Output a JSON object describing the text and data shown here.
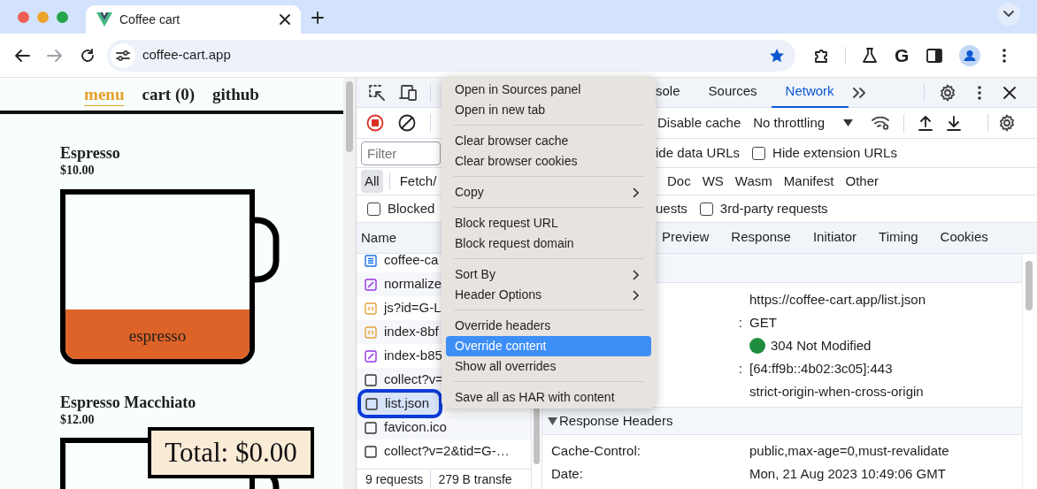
{
  "browser": {
    "tab_title": "Coffee cart",
    "url": "coffee-cart.app",
    "bookmarked": true,
    "extension_letter": "G"
  },
  "page": {
    "nav": [
      {
        "label": "menu",
        "selected": true
      },
      {
        "label": "cart (0)",
        "selected": false
      },
      {
        "label": "github",
        "selected": false
      }
    ],
    "products": [
      {
        "name": "Espresso",
        "price": "$10.00",
        "ingredient": "espresso"
      },
      {
        "name": "Espresso Macchiato",
        "price": "$12.00"
      }
    ],
    "total_button": "Total: $0.00"
  },
  "devtools": {
    "tabs": [
      {
        "label": "sole",
        "selected": false
      },
      {
        "label": "Sources",
        "selected": false
      },
      {
        "label": "Network",
        "selected": true
      }
    ],
    "recording": true,
    "disable_cache_label": "Disable cache",
    "throttling": "No throttling",
    "filter": {
      "placeholder": "Filter"
    },
    "hide_data_urls_label": "ide data URLs",
    "hide_extension_urls": {
      "label": "Hide extension URLs",
      "checked": false
    },
    "type_filters": [
      {
        "label": "All",
        "selected": true
      },
      {
        "label": "Fetch/",
        "selected": false
      },
      {
        "label": "Doc",
        "selected": false
      },
      {
        "label": "WS",
        "selected": false
      },
      {
        "label": "Wasm",
        "selected": false
      },
      {
        "label": "Manifest",
        "selected": false
      },
      {
        "label": "Other",
        "selected": false
      }
    ],
    "blocked": {
      "label": "Blocked",
      "checked": false
    },
    "requests_label": "uests",
    "third_party": {
      "label": "3rd-party requests",
      "checked": false
    },
    "name_column": "Name",
    "detail_tabs": [
      {
        "label": "Preview",
        "selected": false
      },
      {
        "label": "Response",
        "selected": false
      },
      {
        "label": "Initiator",
        "selected": false
      },
      {
        "label": "Timing",
        "selected": false
      },
      {
        "label": "Cookies",
        "selected": false
      }
    ],
    "requests": [
      {
        "name": "coffee-ca",
        "kind": "document",
        "selected": false
      },
      {
        "name": "normalize",
        "kind": "stylesheet",
        "selected": false
      },
      {
        "name": "js?id=G-L",
        "kind": "script",
        "selected": false
      },
      {
        "name": "index-8bf",
        "kind": "script",
        "selected": false
      },
      {
        "name": "index-b85",
        "kind": "stylesheet",
        "selected": false
      },
      {
        "name": "collect?v=",
        "kind": "other",
        "selected": false
      },
      {
        "name": "list.json",
        "kind": "other",
        "selected": true
      },
      {
        "name": "favicon.ico",
        "kind": "other",
        "selected": false
      },
      {
        "name": "collect?v=2&tid=G-…",
        "kind": "other",
        "selected": false
      }
    ],
    "footer": [
      "9 requests",
      "279 B transfe"
    ],
    "general": [
      {
        "value": "https://coffee-cart.app/list.json"
      },
      {
        "label": ":",
        "value": "GET"
      },
      {
        "value": "304 Not Modified",
        "color": "#1e8e3e"
      },
      {
        "label": ":",
        "value": "[64:ff9b::4b02:3c05]:443"
      },
      {
        "value": "strict-origin-when-cross-origin"
      }
    ],
    "response_headers": {
      "title": "Response Headers",
      "expanded": true,
      "rows": [
        {
          "name": "Cache-Control:",
          "value": "public,max-age=0,must-revalidate"
        },
        {
          "name": "Date:",
          "value": "Mon, 21 Aug 2023 10:49:06 GMT"
        }
      ]
    }
  },
  "context_menu": {
    "groups": [
      [
        {
          "label": "Open in Sources panel",
          "submenu": false,
          "selected": false
        },
        {
          "label": "Open in new tab",
          "submenu": false,
          "selected": false
        }
      ],
      [
        {
          "label": "Clear browser cache",
          "submenu": false,
          "selected": false
        },
        {
          "label": "Clear browser cookies",
          "submenu": false,
          "selected": false
        }
      ],
      [
        {
          "label": "Copy",
          "submenu": true,
          "selected": false
        }
      ],
      [
        {
          "label": "Block request URL",
          "submenu": false,
          "selected": false
        },
        {
          "label": "Block request domain",
          "submenu": false,
          "selected": false
        }
      ],
      [
        {
          "label": "Sort By",
          "submenu": true,
          "selected": false
        },
        {
          "label": "Header Options",
          "submenu": true,
          "selected": false
        }
      ],
      [
        {
          "label": "Override headers",
          "submenu": false,
          "selected": false
        },
        {
          "label": "Override content",
          "submenu": false,
          "selected": true
        },
        {
          "label": "Show all overrides",
          "submenu": false,
          "selected": false
        }
      ],
      [
        {
          "label": "Save all as HAR with content",
          "submenu": false,
          "selected": false
        }
      ]
    ]
  }
}
